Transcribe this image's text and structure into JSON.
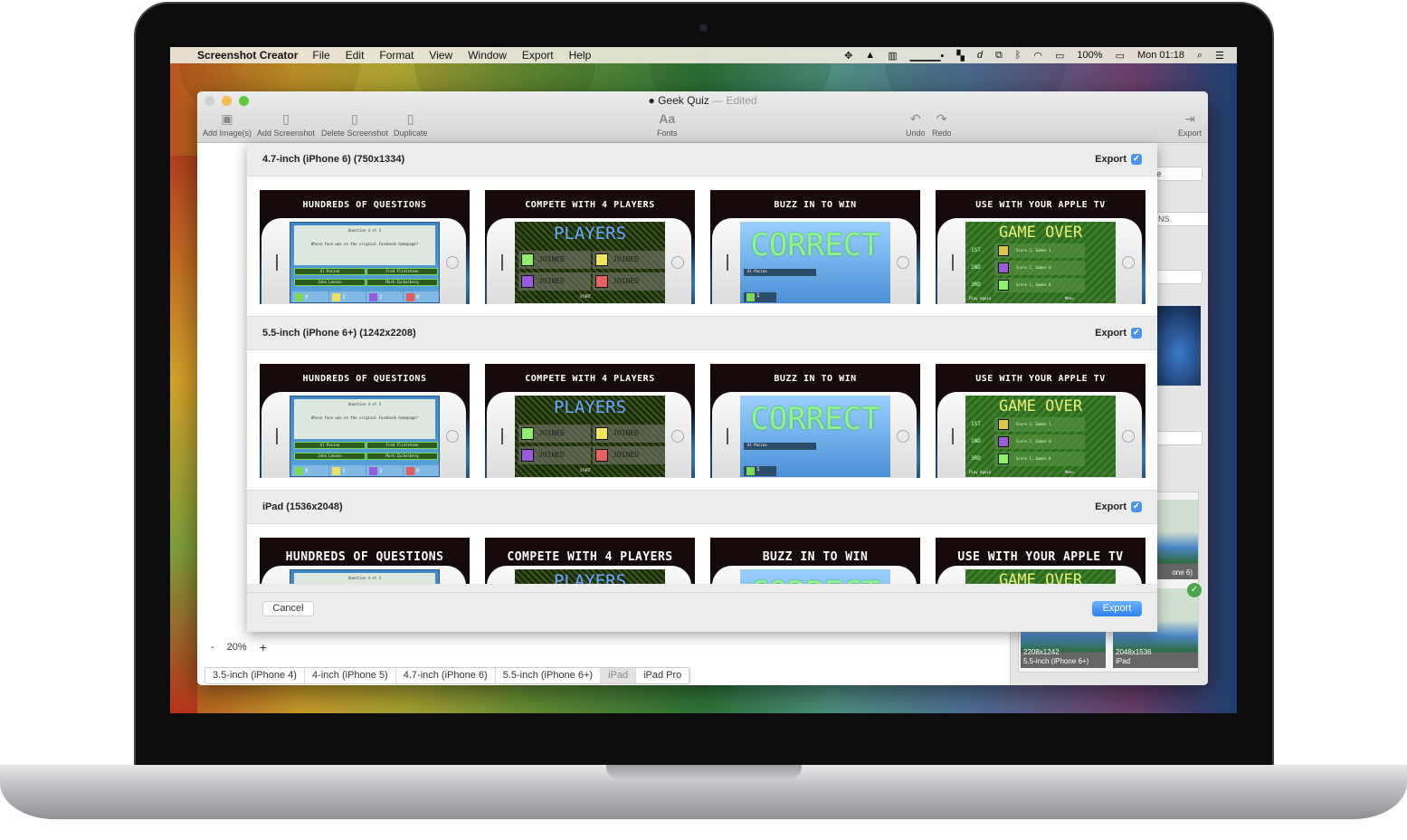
{
  "menubar": {
    "app": "Screenshot Creator",
    "items": [
      "File",
      "Edit",
      "Format",
      "View",
      "Window",
      "Export",
      "Help"
    ],
    "battery": "100%",
    "clock": "Mon 01:18"
  },
  "window": {
    "title": "Geek Quiz",
    "edited": "— Edited",
    "toolbar": {
      "add_images": "Add Image(s)",
      "add_screenshot": "Add Screenshot",
      "delete_screenshot": "Delete Screenshot",
      "duplicate": "Duplicate",
      "fonts": "Fonts",
      "undo": "Undo",
      "redo": "Redo",
      "export": "Export"
    }
  },
  "sheet": {
    "export_label": "Export",
    "sections": [
      {
        "title": "4.7-inch (iPhone 6) (750x1334)",
        "export_checked": true
      },
      {
        "title": "5.5-inch (iPhone 6+) (1242x2208)",
        "export_checked": true
      },
      {
        "title": "iPad (1536x2048)",
        "export_checked": true
      }
    ],
    "cards": [
      {
        "caption": "HUNDREDS OF QUESTIONS",
        "screen": "questions",
        "question_header": "Question 4 of 5",
        "question": "Whose face was on the original Facebook homepage?",
        "answers": [
          "Al Pacino",
          "Fred Flintstone",
          "John Lennon",
          "Mark Zuckerberg"
        ],
        "scores": [
          "0",
          "1",
          "2",
          "0"
        ]
      },
      {
        "caption": "COMPETE WITH 4 PLAYERS",
        "screen": "players",
        "heading": "PLAYERS",
        "status": "JOINED",
        "start": "START"
      },
      {
        "caption": "BUZZ IN TO WIN",
        "screen": "correct",
        "heading": "CORRECT",
        "answer": "Al Pacino",
        "score": "1"
      },
      {
        "caption": "USE WITH YOUR APPLE TV",
        "screen": "gameover",
        "heading": "GAME OVER",
        "places": [
          "1ST",
          "2ND",
          "3RD"
        ],
        "results": [
          "Score 2, Games 1",
          "Score 2, Games 0",
          "Score 1, Games 0"
        ],
        "buttons": [
          "Play Again",
          "Menu"
        ]
      }
    ],
    "cancel": "Cancel",
    "export_button": "Export"
  },
  "zoom": {
    "minus": "-",
    "value": "20%",
    "plus": "+"
  },
  "device_tabs": [
    {
      "label": "3.5-inch (iPhone 4)"
    },
    {
      "label": "4-inch (iPhone 5)"
    },
    {
      "label": "4.7-inch (iPhone 6)"
    },
    {
      "label": "5.5-inch (iPhone 6+)"
    },
    {
      "label": "iPad",
      "selected": true
    },
    {
      "label": "iPad Pro"
    }
  ],
  "sidebar": {
    "field1": "ice",
    "field2": "NS",
    "thumb_label_partial": "one 6)",
    "thumbs": [
      {
        "size": "2208x1242",
        "device": "5.5-inch (iPhone 6+)"
      },
      {
        "size": "2048x1536",
        "device": "iPad",
        "checked": true
      }
    ]
  },
  "colors": {
    "accent": "#3b87f0",
    "checkbox": "#4c93ea",
    "close": "#d0d0d0",
    "minimize": "#f5bd4f",
    "zoom": "#5fc93f"
  }
}
